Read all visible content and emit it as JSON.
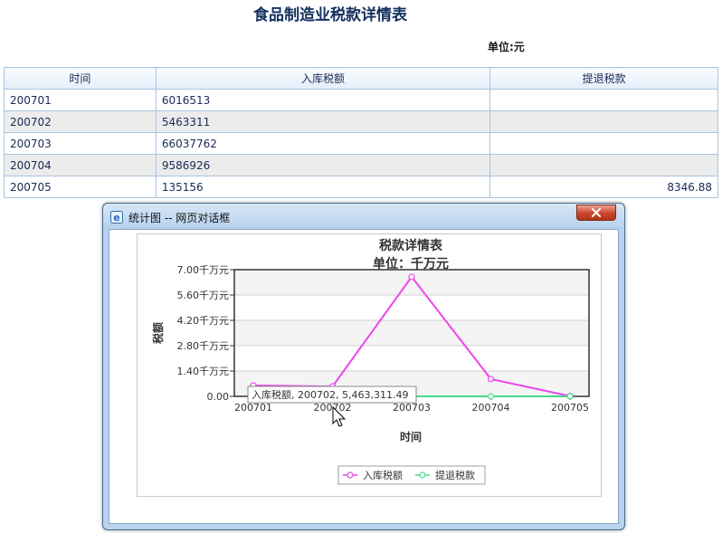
{
  "page": {
    "title": "食品制造业税款详情表",
    "unit": "单位:元"
  },
  "table": {
    "headers": [
      "时间",
      "入库税额",
      "提退税款"
    ],
    "rows": [
      [
        "200701",
        "6016513",
        ""
      ],
      [
        "200702",
        "5463311",
        ""
      ],
      [
        "200703",
        "66037762",
        ""
      ],
      [
        "200704",
        "9586926",
        ""
      ],
      [
        "200705",
        "135156",
        "8346.88"
      ]
    ]
  },
  "dialog": {
    "title": "统计图 -- 网页对话框",
    "icon": "ie-icon",
    "close_icon": "close-icon"
  },
  "chart_data": {
    "type": "line",
    "title": "税款详情表",
    "subtitle": "单位：千万元",
    "xlabel": "时间",
    "ylabel": "税额",
    "categories": [
      "200701",
      "200702",
      "200703",
      "200704",
      "200705"
    ],
    "ylim": [
      0,
      7.0
    ],
    "yticks": [
      "0.00",
      "1.40千万元",
      "2.80千万元",
      "4.20千万元",
      "5.60千万元",
      "7.00千万元"
    ],
    "grid": true,
    "legend_position": "bottom",
    "series": [
      {
        "name": "入库税额",
        "color": "#ee44ee",
        "values": [
          0.6016513,
          0.5463311,
          6.6037762,
          0.9586926,
          0.0135156
        ]
      },
      {
        "name": "提退税款",
        "color": "#44dd88",
        "values": [
          0,
          0,
          0,
          0,
          0.000834688
        ]
      }
    ],
    "tooltip": "入库税额, 200702, 5,463,311.49"
  }
}
